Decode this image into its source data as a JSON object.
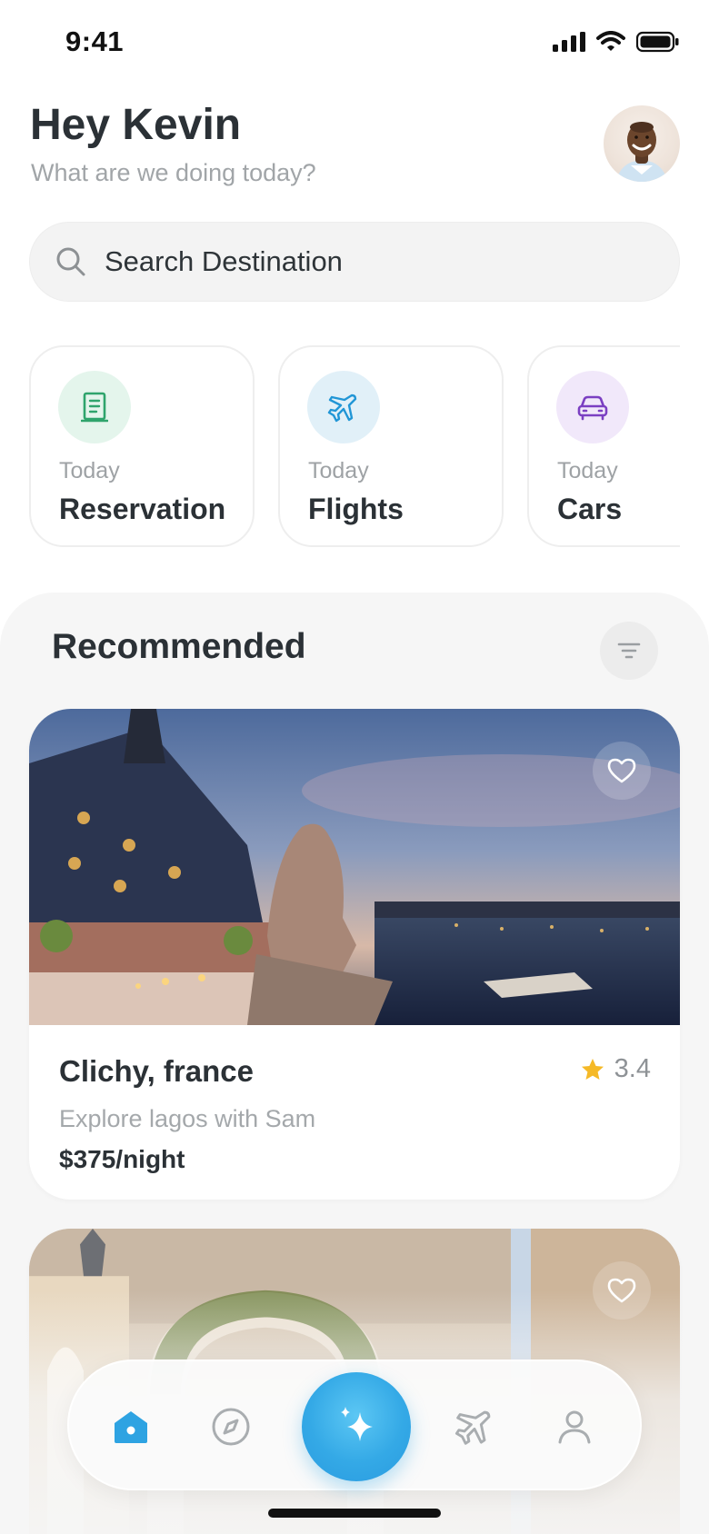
{
  "status_bar": {
    "time": "9:41"
  },
  "header": {
    "greeting": "Hey Kevin",
    "subtitle": "What are we doing today?"
  },
  "search": {
    "placeholder": "Search Destination"
  },
  "categories": [
    {
      "when": "Today",
      "label": "Reservation",
      "icon": "document-icon",
      "icon_bg": "#e4f5ec",
      "icon_color": "#2fa46c"
    },
    {
      "when": "Today",
      "label": "Flights",
      "icon": "plane-icon",
      "icon_bg": "#e1f0f8",
      "icon_color": "#2196d6"
    },
    {
      "when": "Today",
      "label": "Cars",
      "icon": "car-icon",
      "icon_bg": "#f1e8fa",
      "icon_color": "#7b3fc2"
    }
  ],
  "recommended": {
    "title": "Recommended",
    "cards": [
      {
        "place": "Clichy, france",
        "rating": "3.4",
        "description": "Explore lagos with Sam",
        "price": "$375/night"
      }
    ]
  },
  "bottom_nav": {
    "items": [
      "home-icon",
      "compass-icon",
      "sparkle-icon",
      "plane-icon",
      "profile-icon"
    ],
    "active": "home-icon"
  },
  "colors": {
    "accent": "#2ea3e2",
    "star": "#f5b927",
    "panel_bg": "#f6f6f6"
  }
}
